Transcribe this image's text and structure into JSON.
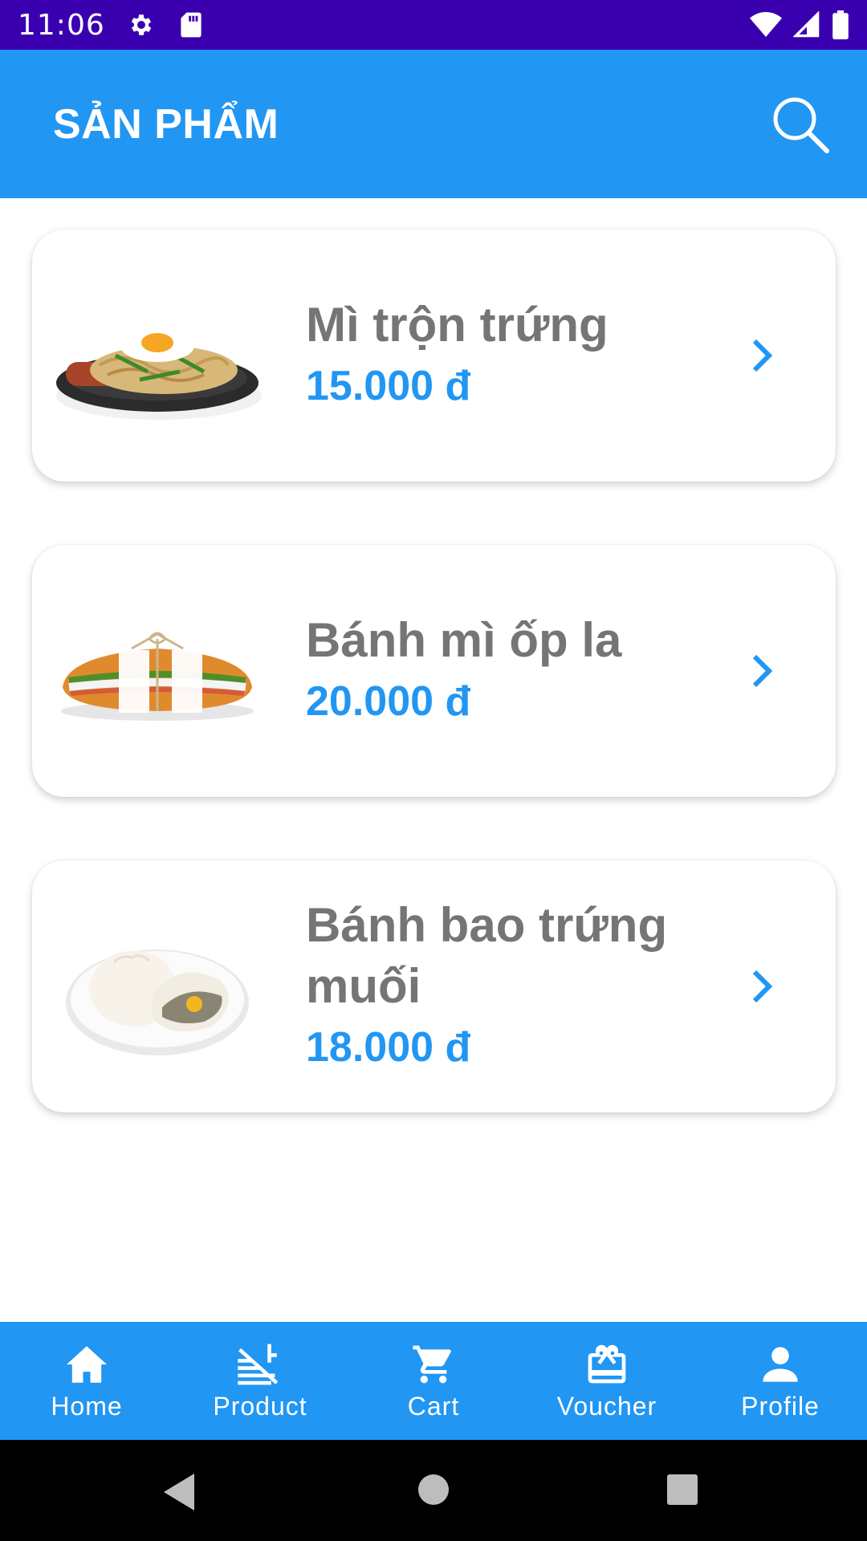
{
  "status_bar": {
    "time": "11:06",
    "icons": [
      "gear-icon",
      "sd-card-icon",
      "wifi-icon",
      "signal-icon",
      "battery-icon"
    ]
  },
  "app_bar": {
    "title": "SẢN PHẨM",
    "search_icon": "search-icon"
  },
  "products": [
    {
      "name": "Mì trộn trứng",
      "price": "15.000 đ",
      "image": "noodles-with-egg"
    },
    {
      "name": "Bánh mì ốp la",
      "price": "20.000 đ",
      "image": "baguette-sandwich"
    },
    {
      "name": "Bánh bao trứng muối",
      "price": "18.000 đ",
      "image": "steamed-buns"
    }
  ],
  "bottom_nav": {
    "items": [
      {
        "label": "Home",
        "icon": "home-icon"
      },
      {
        "label": "Product",
        "icon": "product-icon"
      },
      {
        "label": "Cart",
        "icon": "cart-icon"
      },
      {
        "label": "Voucher",
        "icon": "voucher-icon"
      },
      {
        "label": "Profile",
        "icon": "profile-icon"
      }
    ]
  },
  "colors": {
    "status_bar": "#3a00b0",
    "primary": "#2196f3",
    "product_name": "#757575",
    "price": "#2196f3"
  }
}
